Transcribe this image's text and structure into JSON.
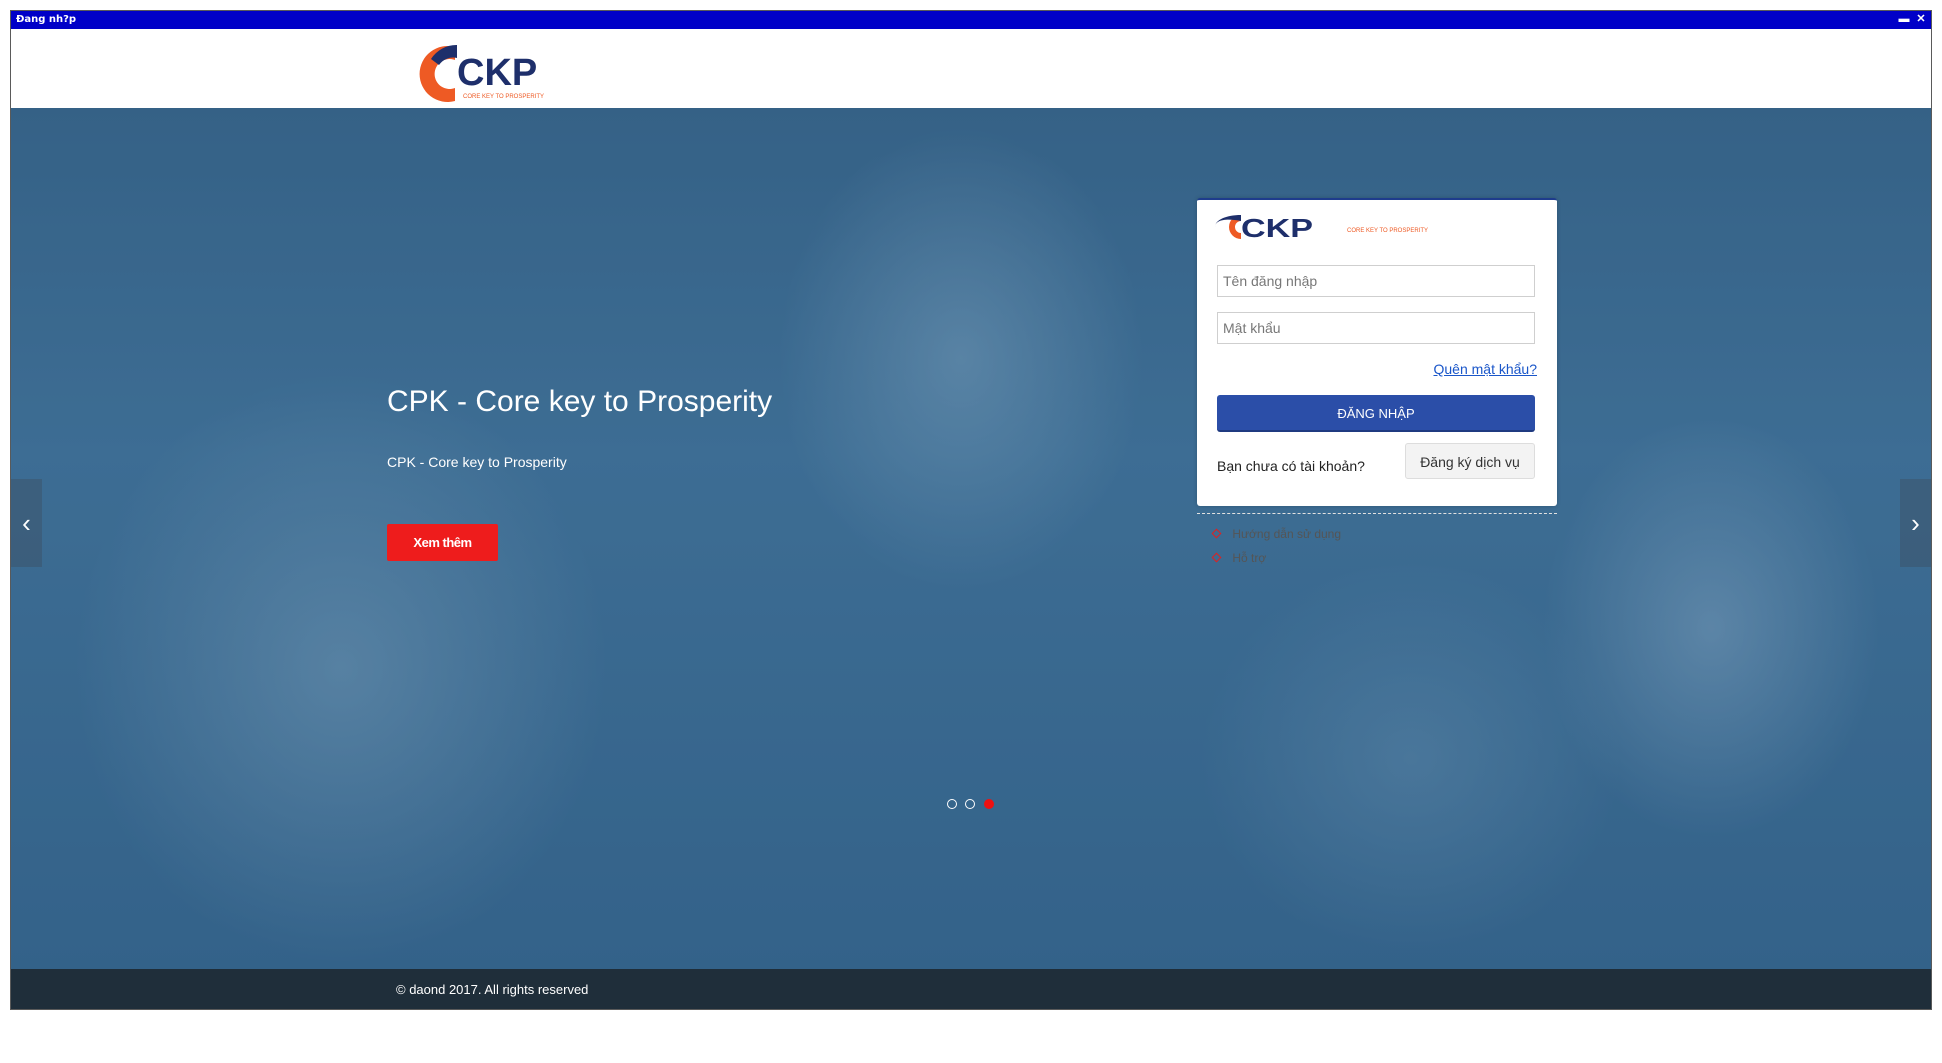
{
  "window": {
    "title": "Đang nh?p",
    "minimize_glyph": "▬",
    "close_glyph": "✕"
  },
  "header": {
    "logo_text": "CKP",
    "logo_tagline": "CORE KEY TO PROSPERITY"
  },
  "slider": {
    "title": "CPK - Core key to Prosperity",
    "subtitle": "CPK - Core key to Prosperity",
    "button_label": "Xem thêm",
    "prev_glyph": "‹",
    "next_glyph": "›",
    "dots": [
      {
        "active": false
      },
      {
        "active": false
      },
      {
        "active": true
      }
    ]
  },
  "login": {
    "logo_text": "CKP",
    "logo_tagline": "CORE KEY TO PROSPERITY",
    "username_placeholder": "Tên đăng nhập",
    "password_placeholder": "Mật khẩu",
    "forgot_label": "Quên mật khẩu?",
    "login_label": "ĐĂNG NHẬP",
    "no_account_text": "Bạn chưa có tài khoản?",
    "register_label": "Đăng ký dịch vụ",
    "links": [
      {
        "label": "Hướng dẫn sử dụng",
        "icon": "diamond-bullet-icon"
      },
      {
        "label": "Hỗ trợ",
        "icon": "diamond-bullet-icon"
      }
    ]
  },
  "footer": {
    "copyright": "© daond 2017. All rights reserved"
  },
  "colors": {
    "titlebar": "#0000c8",
    "brand_orange": "#ee5a24",
    "brand_navy": "#1e2f6b",
    "primary_button": "#2b4ea8",
    "cta_red": "#ee1c1c",
    "footer": "#1f2e3a"
  }
}
